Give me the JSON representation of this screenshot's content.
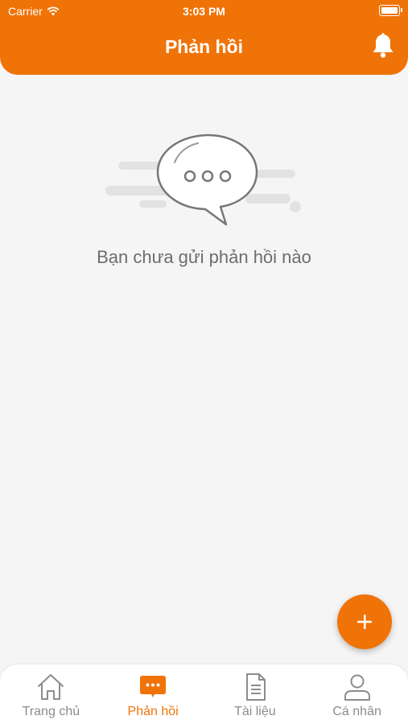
{
  "status_bar": {
    "carrier": "Carrier",
    "time": "3:03 PM"
  },
  "header": {
    "title": "Phản hồi",
    "bell_icon": "bell-icon"
  },
  "empty_state": {
    "message": "Bạn chưa gửi phản hồi nào",
    "icon": "chat-bubble-icon"
  },
  "fab": {
    "icon": "plus-icon"
  },
  "tabs": [
    {
      "label": "Trang chủ",
      "icon": "home-icon",
      "active": false
    },
    {
      "label": "Phản hồi",
      "icon": "chat-icon",
      "active": true
    },
    {
      "label": "Tài liệu",
      "icon": "document-icon",
      "active": false
    },
    {
      "label": "Cá nhân",
      "icon": "person-icon",
      "active": false
    }
  ],
  "colors": {
    "accent": "#f07308",
    "background": "#f5f5f5",
    "inactive": "#8c8c8c"
  }
}
